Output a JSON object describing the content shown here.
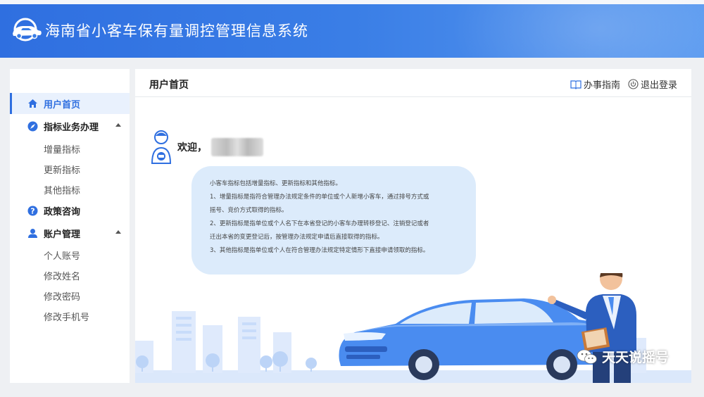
{
  "header": {
    "app_title": "海南省小客车保有量调控管理信息系统",
    "logo_icon": "car-logo-icon"
  },
  "sidebar": {
    "items": [
      {
        "label": "用户首页",
        "icon": "home-icon",
        "active": true
      },
      {
        "label": "指标业务办理",
        "icon": "compass-icon",
        "expanded": true,
        "children": [
          "增量指标",
          "更新指标",
          "其他指标"
        ]
      },
      {
        "label": "政策咨询",
        "icon": "question-icon"
      },
      {
        "label": "账户管理",
        "icon": "user-icon",
        "expanded": true,
        "children": [
          "个人账号",
          "修改姓名",
          "修改密码",
          "修改手机号"
        ]
      }
    ]
  },
  "main": {
    "page_title": "用户首页",
    "guide_link": "办事指南",
    "logout_link": "退出登录",
    "welcome": "欢迎，",
    "info_lines": [
      "小客车指标包括增量指标、更新指标和其他指标。",
      "1、增量指标是指符合管理办法规定条件的单位或个人新增小客车，通过排号方式或",
      "摇号、竞价方式取得的指标。",
      "2、更新指标是指单位或个人名下在本省登记的小客车办理转移登记、注销登记或者",
      "迁出本省的变更登记后，按管理办法规定申请后直接取得的指标。",
      "3、其他指标是指单位或个人在符合管理办法规定特定情形下直接申请领取的指标。"
    ]
  },
  "watermark": {
    "text": "天天说摇号",
    "icon": "wechat-icon"
  },
  "colors": {
    "primary": "#2f6fe0",
    "bubble": "#dcebfb",
    "car": "#4a8cf0"
  }
}
